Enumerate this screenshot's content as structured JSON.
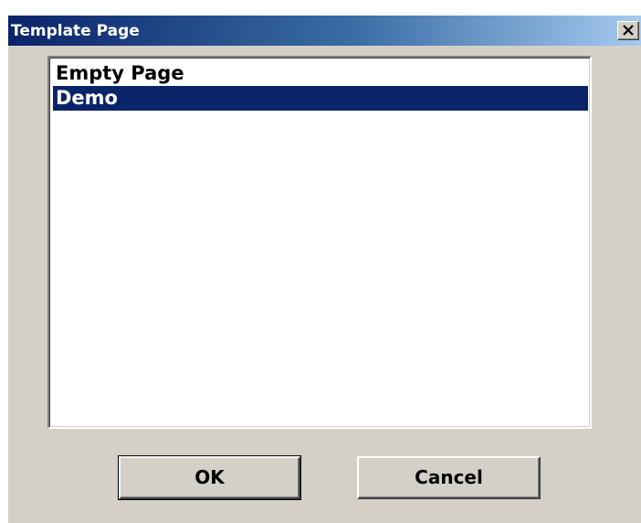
{
  "window": {
    "title": "Template Page",
    "close_icon": "close-x-icon"
  },
  "template_list": {
    "items": [
      {
        "label": "Empty Page",
        "selected": false
      },
      {
        "label": "Demo",
        "selected": true
      }
    ]
  },
  "buttons": {
    "ok_label": "OK",
    "cancel_label": "Cancel"
  },
  "colors": {
    "titlebar_start": "#0a246a",
    "titlebar_end": "#a6caf0",
    "selection": "#0a246a",
    "face": "#d4d0c8"
  }
}
